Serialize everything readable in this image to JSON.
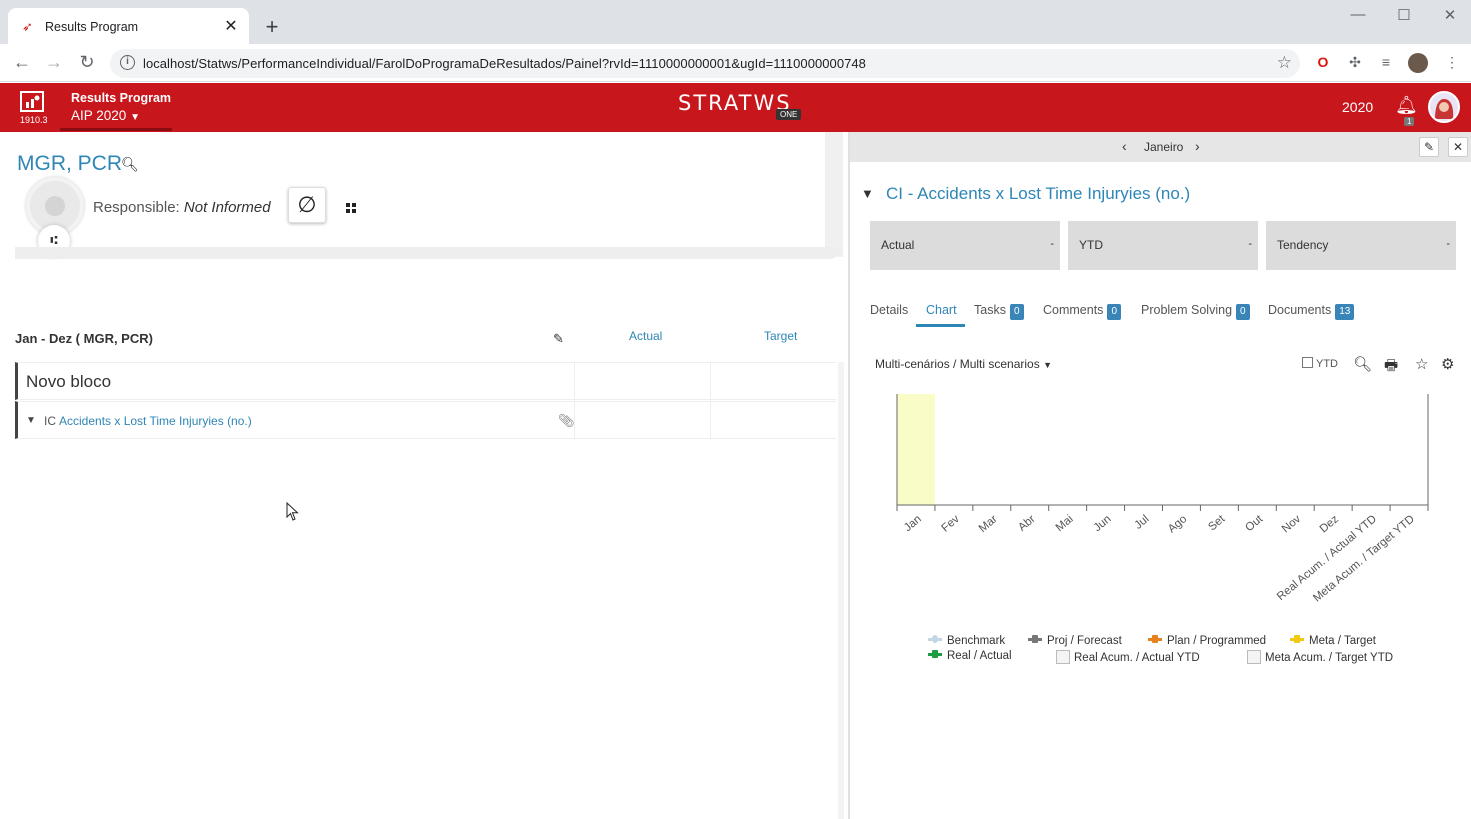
{
  "browser": {
    "tab_title": "Results Program",
    "url": "localhost/Statws/PerformanceIndividual/FarolDoProgramaDeResultados/Painel?rvId=1110000000001&ugId=1110000000748"
  },
  "app": {
    "version": "1910.3",
    "program_label": "Results Program",
    "program_selected": "AIP 2020",
    "brand": "STRATWS",
    "brand_tag": "ONE",
    "year": "2020",
    "notification_count": "1",
    "accent_color": "#c8161d"
  },
  "left": {
    "title": "MGR, PCR",
    "responsible_label": "Responsible:",
    "responsible_value": "Not Informed",
    "period_label": "Jan - Dez ( MGR, PCR)",
    "col_actual": "Actual",
    "col_target": "Target",
    "block_label": "Novo bloco",
    "indicator_prefix": "IC",
    "indicator_name": "Accidents x Lost Time Injuryies (no.)"
  },
  "right": {
    "month": "Janeiro",
    "indicator_title": "CI - Accidents x Lost Time Injuryies (no.)",
    "kpis": [
      {
        "label": "Actual",
        "value": "-"
      },
      {
        "label": "YTD",
        "value": "-"
      },
      {
        "label": "Tendency",
        "value": "-"
      }
    ],
    "tabs": [
      {
        "label": "Details",
        "count": null
      },
      {
        "label": "Chart",
        "count": null
      },
      {
        "label": "Tasks",
        "count": "0"
      },
      {
        "label": "Comments",
        "count": "0"
      },
      {
        "label": "Problem Solving",
        "count": "0"
      },
      {
        "label": "Documents",
        "count": "13"
      }
    ],
    "active_tab": "Chart",
    "scenario_select": "Multi-cenários / Multi scenarios",
    "ytd_label": "YTD"
  },
  "chart_data": {
    "type": "bar",
    "categories": [
      "Jan",
      "Fev",
      "Mar",
      "Abr",
      "Mai",
      "Jun",
      "Jul",
      "Ago",
      "Set",
      "Out",
      "Nov",
      "Dez",
      "Real Acum. / Actual YTD",
      "Meta Acum. / Target YTD"
    ],
    "highlighted_category": "Jan",
    "highlight_color": "#fafcc8",
    "series": [
      {
        "name": "Benchmark",
        "values": [],
        "color": "#c3d6e4"
      },
      {
        "name": "Proj / Forecast",
        "values": [],
        "color": "#777777"
      },
      {
        "name": "Plan / Programmed",
        "values": [],
        "color": "#e8821e"
      },
      {
        "name": "Meta / Target",
        "values": [],
        "color": "#f2c811"
      },
      {
        "name": "Real / Actual",
        "values": [],
        "color": "#1a9e3f"
      },
      {
        "name": "Real Acum. / Actual YTD",
        "values": [],
        "color": "#999999"
      },
      {
        "name": "Meta Acum. / Target YTD",
        "values": [],
        "color": "#999999"
      }
    ],
    "grid": false,
    "legend": "bottom"
  }
}
